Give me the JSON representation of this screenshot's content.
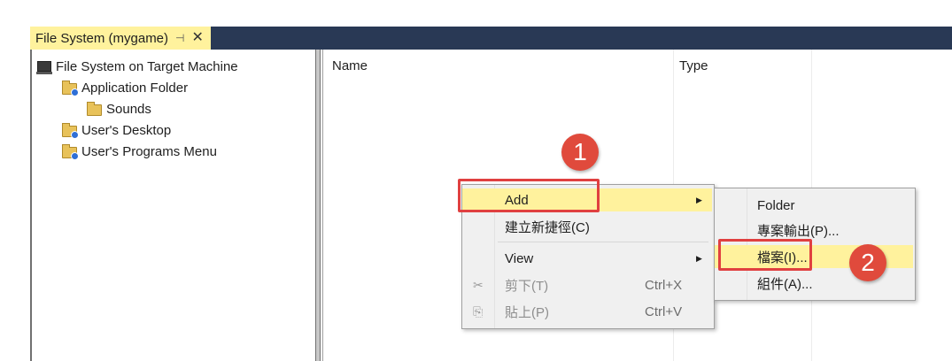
{
  "tab": {
    "title": "File System (mygame)",
    "pin_icon": "⊣",
    "close_icon": "✕"
  },
  "tree": {
    "root": "File System on Target Machine",
    "items": [
      {
        "label": "Application Folder"
      },
      {
        "label": "Sounds"
      },
      {
        "label": "User's Desktop"
      },
      {
        "label": "User's Programs Menu"
      }
    ]
  },
  "list": {
    "columns": [
      "Name",
      "Type"
    ]
  },
  "context_menu": {
    "add": "Add",
    "create_shortcut": "建立新捷徑(C)",
    "view": "View",
    "cut": "剪下(T)",
    "cut_shortcut": "Ctrl+X",
    "paste": "貼上(P)",
    "paste_shortcut": "Ctrl+V"
  },
  "submenu": {
    "folder": "Folder",
    "project_output": "專案輸出(P)...",
    "file": "檔案(I)...",
    "assembly": "組件(A)..."
  },
  "markers": {
    "one": "1",
    "two": "2"
  },
  "colors": {
    "tab_active": "#fff29d",
    "tab_bar": "#293955",
    "highlight": "#fff29d",
    "annotation": "#e04040"
  }
}
